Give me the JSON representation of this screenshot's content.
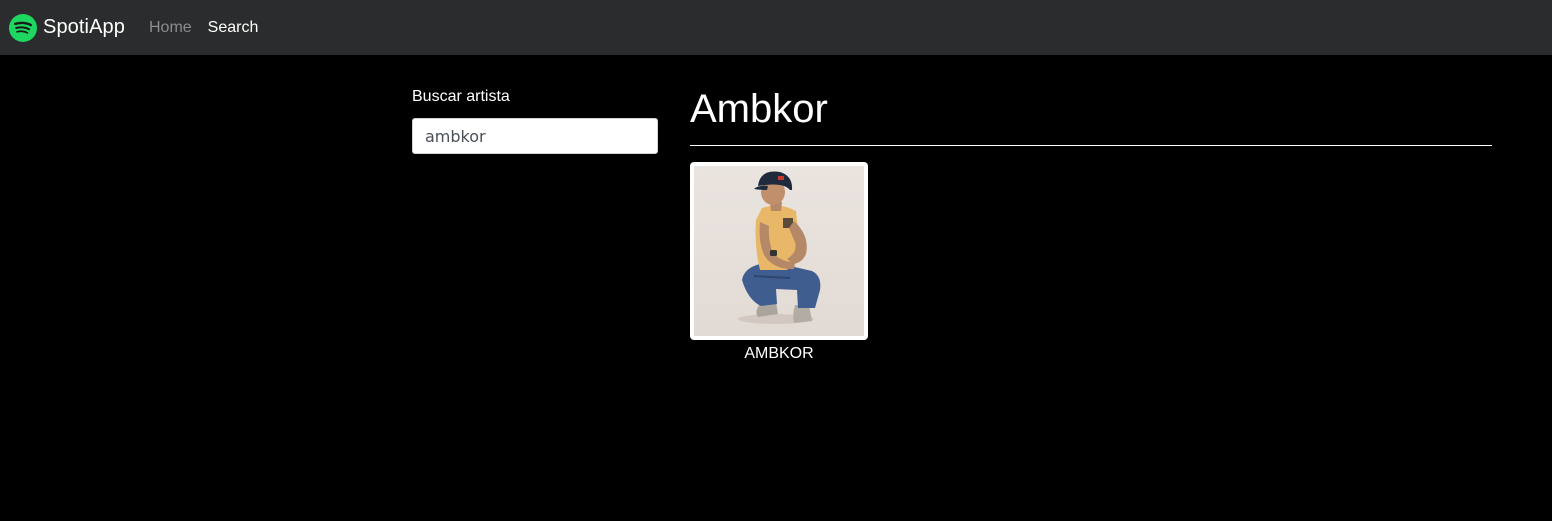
{
  "navbar": {
    "brand": "SpotiApp",
    "brand_icon": "spotify-logo-icon",
    "brand_color": "#1ed760",
    "background": "#2b2c2d",
    "links": [
      {
        "label": "Home",
        "active": false
      },
      {
        "label": "Search",
        "active": true
      }
    ]
  },
  "search": {
    "label": "Buscar artista",
    "value": "ambkor",
    "placeholder": ""
  },
  "results": {
    "title": "Ambkor",
    "artists": [
      {
        "name": "AMBKOR",
        "image": "artist-photo"
      }
    ]
  }
}
